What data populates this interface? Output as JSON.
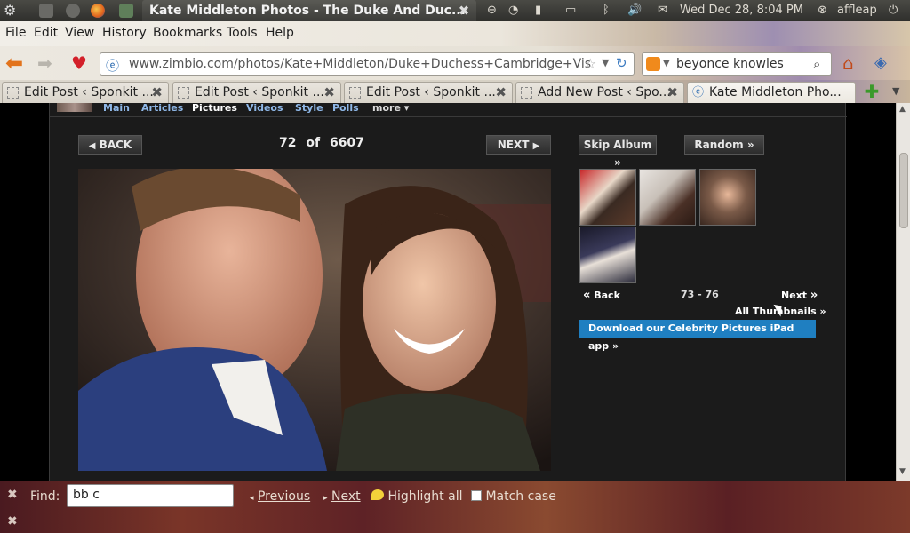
{
  "top_panel": {
    "window_title": "Kate Middleton Photos - The Duke And Duc...",
    "datetime": "Wed Dec 28,  8:04 PM",
    "username": "affleap"
  },
  "menubar": {
    "items": [
      "File",
      "Edit",
      "View",
      "History",
      "Bookmarks",
      "Tools",
      "Help"
    ]
  },
  "navbar": {
    "url": "www.zimbio.com/photos/Kate+Middleton/Duke+Duchess+Cambridge+Visit+",
    "search_value": "beyonce knowles"
  },
  "tabs": [
    {
      "label": "Edit Post ‹ Sponkit ..."
    },
    {
      "label": "Edit Post ‹ Sponkit ..."
    },
    {
      "label": "Edit Post ‹ Sponkit ..."
    },
    {
      "label": "Add New Post ‹ Spo..."
    },
    {
      "label": "Kate Middleton Pho..."
    }
  ],
  "site_nav": {
    "items": [
      "Main",
      "Articles",
      "Pictures",
      "Videos",
      "Style",
      "Polls",
      "more ▾"
    ],
    "current": "Pictures"
  },
  "gallery": {
    "back_label": "BACK",
    "next_label": "NEXT",
    "current_index": "72",
    "of_label": "of",
    "total": "6607",
    "skip_album_label": "Skip Album »",
    "random_label": "Random »",
    "thumbs_back_label": "Back",
    "thumbs_range": "73 - 76",
    "thumbs_next_label": "Next",
    "all_thumbnails_label": "All Thumbnails »",
    "ipad_label": "Download our Celebrity Pictures iPad app »"
  },
  "findbar": {
    "find_label": "Find:",
    "find_value": "bb c",
    "previous_label": "Previous",
    "next_label": "Next",
    "highlight_label": "Highlight all",
    "match_case_label": "Match case"
  },
  "colors": {
    "link_blue": "#8fb8e8",
    "ipad_button": "#1f7fc1"
  }
}
